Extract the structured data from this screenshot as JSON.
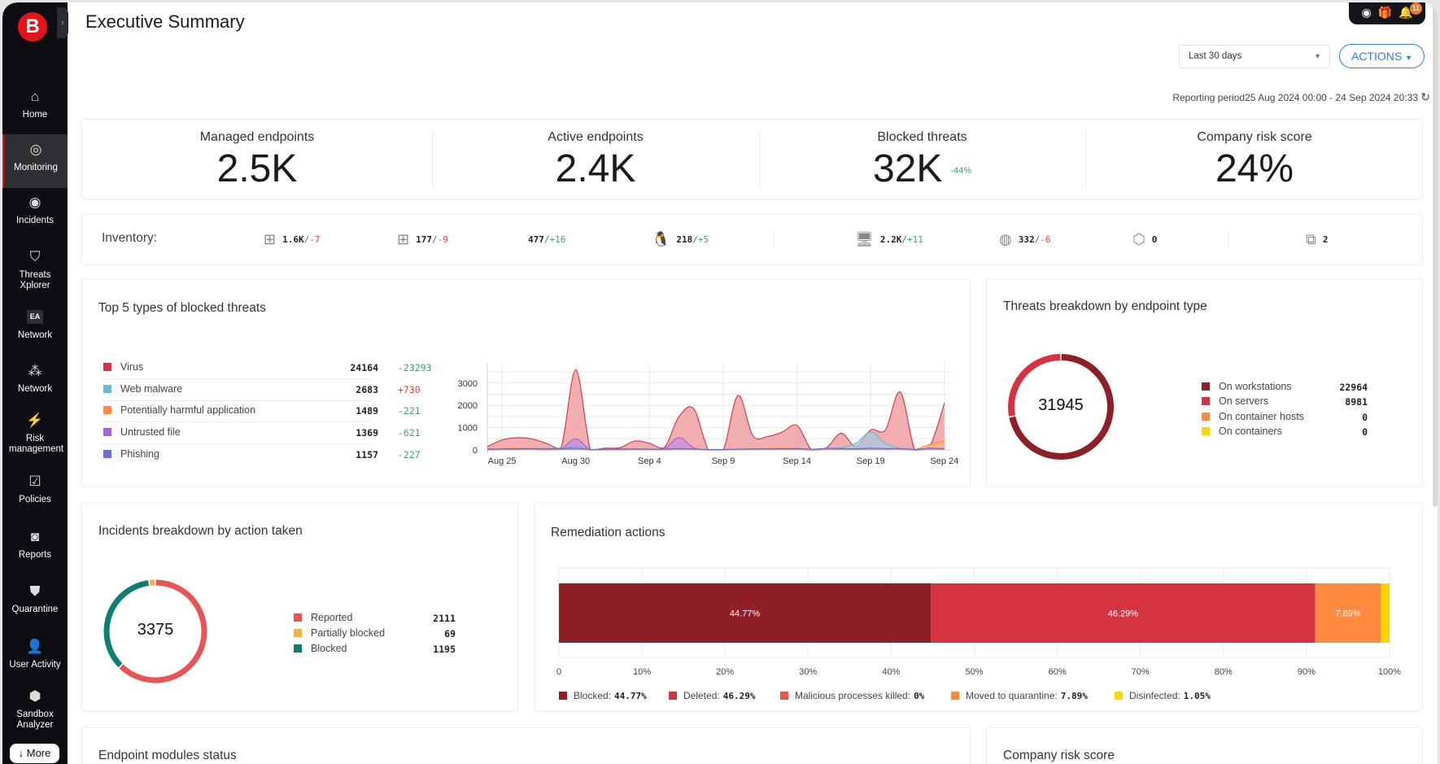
{
  "sidebar": {
    "logo": "B",
    "items": [
      {
        "label": "Home",
        "icon": "home-icon",
        "glyph": "⌂"
      },
      {
        "label": "Monitoring",
        "icon": "gauge-icon",
        "glyph": "◎"
      },
      {
        "label": "Incidents",
        "icon": "incidents-icon",
        "glyph": "◉"
      },
      {
        "label": "Threats Xplorer",
        "icon": "shield-alert-icon",
        "glyph": "⛉"
      },
      {
        "label": "Network",
        "icon": "ea-badge-icon",
        "glyph": "EA"
      },
      {
        "label": "Network",
        "icon": "network-icon",
        "glyph": "⁂"
      },
      {
        "label": "Risk management",
        "icon": "risk-icon",
        "glyph": "⚡"
      },
      {
        "label": "Policies",
        "icon": "policies-icon",
        "glyph": "☑"
      },
      {
        "label": "Reports",
        "icon": "reports-icon",
        "glyph": "◙"
      },
      {
        "label": "Quarantine",
        "icon": "quarantine-icon",
        "glyph": "⛊"
      },
      {
        "label": "User Activity",
        "icon": "user-icon",
        "glyph": "👤"
      },
      {
        "label": "Sandbox Analyzer",
        "icon": "sandbox-icon",
        "glyph": "⬢"
      }
    ],
    "more": "↓ More"
  },
  "header": {
    "title": "Executive Summary",
    "notifications": "11",
    "period_select": "Last 30 days",
    "actions": "ACTIONS",
    "reporting_period": "Reporting period25 Aug 2024 00:00 - 24 Sep 2024 20:33"
  },
  "kpis": [
    {
      "label": "Managed endpoints",
      "value": "2.5K"
    },
    {
      "label": "Active endpoints",
      "value": "2.4K"
    },
    {
      "label": "Blocked threats",
      "value": "32K",
      "delta": "-44%"
    },
    {
      "label": "Company risk score",
      "value": "24%"
    }
  ],
  "inventory": {
    "label": "Inventory:",
    "items": [
      {
        "icon": "windows-workstation-icon",
        "glyph": "⊞",
        "value": "1.6K",
        "delta": "-7",
        "dir": "neg"
      },
      {
        "icon": "windows-server-icon",
        "glyph": "⊞",
        "value": "177",
        "delta": "-9",
        "dir": "neg"
      },
      {
        "icon": "apple-icon",
        "glyph": "",
        "value": "477",
        "delta": "+16",
        "dir": "pos"
      },
      {
        "icon": "linux-icon",
        "glyph": "🐧",
        "value": "218",
        "delta": "+5",
        "dir": "pos"
      },
      {
        "icon": "physical-machine-icon",
        "glyph": "🖥",
        "value": "2.2K",
        "delta": "+11",
        "dir": "pos"
      },
      {
        "icon": "virtual-machine-icon",
        "glyph": "◍",
        "value": "332",
        "delta": "-6",
        "dir": "neg"
      },
      {
        "icon": "container-icon",
        "glyph": "⬡",
        "value": "0"
      },
      {
        "icon": "container-hosts-icon",
        "glyph": "⧉",
        "value": "2"
      }
    ]
  },
  "top_threats": {
    "title": "Top 5 types of blocked threats",
    "rows": [
      {
        "name": "Virus",
        "count": "24164",
        "delta": "-23293",
        "dir": "pos",
        "color": "#d63340"
      },
      {
        "name": "Web malware",
        "count": "2683",
        "delta": "+730",
        "dir": "neg",
        "color": "#6bb6dc"
      },
      {
        "name": "Potentially harmful application",
        "count": "1489",
        "delta": "-221",
        "dir": "pos",
        "color": "#ff8a3d"
      },
      {
        "name": "Untrusted file",
        "count": "1369",
        "delta": "-621",
        "dir": "pos",
        "color": "#a463d8"
      },
      {
        "name": "Phishing",
        "count": "1157",
        "delta": "-227",
        "dir": "pos",
        "color": "#6a6ad8"
      }
    ]
  },
  "chart_data": {
    "type": "area",
    "title": "Top 5 types of blocked threats",
    "xlabel": "",
    "ylabel": "",
    "x": [
      "Aug 24",
      "Aug 25",
      "Aug 26",
      "Aug 27",
      "Aug 28",
      "Aug 29",
      "Aug 30",
      "Aug 31",
      "Sep 1",
      "Sep 2",
      "Sep 3",
      "Sep 4",
      "Sep 5",
      "Sep 6",
      "Sep 7",
      "Sep 8",
      "Sep 9",
      "Sep 10",
      "Sep 11",
      "Sep 12",
      "Sep 13",
      "Sep 14",
      "Sep 15",
      "Sep 16",
      "Sep 17",
      "Sep 18",
      "Sep 19",
      "Sep 20",
      "Sep 21",
      "Sep 22",
      "Sep 23",
      "Sep 24"
    ],
    "x_ticks": [
      "Aug 25",
      "Aug 30",
      "Sep 4",
      "Sep 9",
      "Sep 14",
      "Sep 19",
      "Sep 24"
    ],
    "y_ticks": [
      0,
      1000,
      2000,
      3000
    ],
    "ylim": [
      0,
      4000
    ],
    "grid": true,
    "series": [
      {
        "name": "Virus",
        "fill": "#eea0a3",
        "stroke": "#d0404a",
        "values": [
          150,
          450,
          550,
          500,
          300,
          100,
          3600,
          0,
          80,
          100,
          400,
          300,
          100,
          1500,
          1850,
          0,
          0,
          2450,
          650,
          600,
          800,
          1100,
          0,
          100,
          750,
          150,
          900,
          900,
          2600,
          0,
          150,
          2100
        ]
      },
      {
        "name": "Untrusted file",
        "fill": "#c58be0",
        "stroke": "#a463d8",
        "values": [
          0,
          20,
          30,
          20,
          10,
          50,
          500,
          0,
          10,
          10,
          20,
          20,
          50,
          550,
          100,
          0,
          0,
          20,
          20,
          20,
          30,
          30,
          0,
          20,
          30,
          30,
          50,
          40,
          60,
          0,
          30,
          60
        ]
      },
      {
        "name": "Web malware",
        "fill": "#a9c8dc",
        "stroke": "#6bb6dc",
        "values": [
          30,
          40,
          40,
          50,
          60,
          80,
          150,
          20,
          30,
          40,
          50,
          40,
          30,
          60,
          40,
          10,
          10,
          40,
          50,
          60,
          60,
          70,
          30,
          60,
          100,
          300,
          800,
          300,
          80,
          20,
          60,
          60
        ]
      },
      {
        "name": "Potentially harmful application",
        "fill": "#ffb27a",
        "stroke": "#ff8a3d",
        "values": [
          20,
          60,
          80,
          50,
          30,
          20,
          60,
          10,
          20,
          20,
          30,
          30,
          20,
          40,
          30,
          10,
          10,
          20,
          40,
          60,
          80,
          60,
          20,
          30,
          50,
          40,
          60,
          50,
          60,
          20,
          250,
          400
        ]
      },
      {
        "name": "Phishing",
        "fill": "#9a9ae8",
        "stroke": "#6a6ad8",
        "values": [
          40,
          40,
          50,
          60,
          50,
          60,
          80,
          20,
          30,
          40,
          40,
          30,
          30,
          60,
          40,
          20,
          20,
          30,
          40,
          50,
          50,
          60,
          30,
          70,
          60,
          50,
          80,
          60,
          60,
          20,
          80,
          50
        ]
      }
    ]
  },
  "threats_breakdown": {
    "title": "Threats breakdown by endpoint type",
    "total": "31945",
    "rows": [
      {
        "name": "On workstations",
        "value": 22964,
        "label": "22964",
        "color": "#8e1f27"
      },
      {
        "name": "On servers",
        "value": 8981,
        "label": "8981",
        "color": "#d63340"
      },
      {
        "name": "On container hosts",
        "value": 0,
        "label": "0",
        "color": "#ff8a3d"
      },
      {
        "name": "On containers",
        "value": 0,
        "label": "0",
        "color": "#ffd400"
      }
    ]
  },
  "incidents": {
    "title": "Incidents breakdown by action taken",
    "total": "3375",
    "rows": [
      {
        "name": "Reported",
        "value": 2111,
        "label": "2111",
        "color": "#e85555"
      },
      {
        "name": "Partially blocked",
        "value": 69,
        "label": "69",
        "color": "#f5b041"
      },
      {
        "name": "Blocked",
        "value": 1195,
        "label": "1195",
        "color": "#0e7d72"
      }
    ],
    "order": [
      0,
      2,
      1
    ]
  },
  "remediation": {
    "title": "Remediation actions",
    "ticks": [
      "0",
      "10%",
      "20%",
      "30%",
      "40%",
      "50%",
      "60%",
      "70%",
      "80%",
      "90%",
      "100%"
    ],
    "segments": [
      {
        "name": "Blocked:",
        "pct": 44.77,
        "label": "44.77%",
        "color": "#8e1f27"
      },
      {
        "name": "Deleted:",
        "pct": 46.29,
        "label": "46.29%",
        "color": "#d63340"
      },
      {
        "name": "Malicious processes killed:",
        "pct": 0,
        "label": "0%",
        "color": "#e85555"
      },
      {
        "name": "Moved to quarantine:",
        "pct": 7.89,
        "label": "7.89%",
        "color": "#ff8a3d"
      },
      {
        "name": "Disinfected:",
        "pct": 1.05,
        "label": "1.05%",
        "color": "#ffd400"
      }
    ]
  },
  "bottom": {
    "modules_title": "Endpoint modules status",
    "risk_title": "Company risk score"
  }
}
